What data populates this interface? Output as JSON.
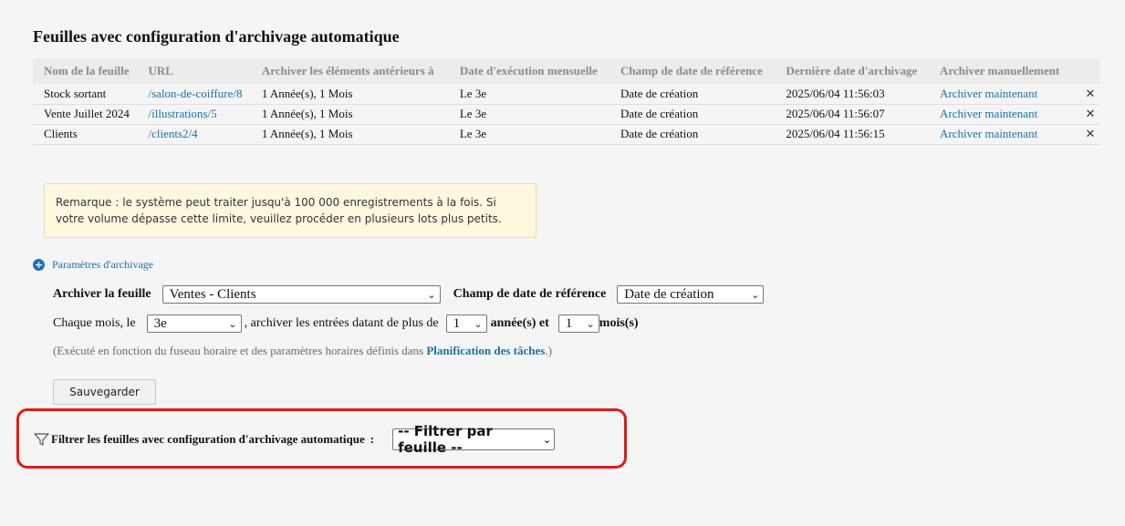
{
  "page": {
    "title": "Feuilles avec configuration d'archivage automatique"
  },
  "table": {
    "headers": [
      "Nom de la feuille",
      "URL",
      "Archiver les éléments antérieurs à",
      "Date d'exécution mensuelle",
      "Champ de date de référence",
      "Dernière date d'archivage",
      "Archiver manuellement"
    ],
    "rows": [
      {
        "name": "Stock sortant",
        "url": "/salon-de-coiffure/8",
        "older_than": "1 Année(s), 1 Mois",
        "monthly_date": "Le 3e",
        "ref_field": "Date de création",
        "last_archive": "2025/06/04 11:56:03",
        "action": "Archiver maintenant",
        "delete": "✕"
      },
      {
        "name": "Vente Juillet 2024",
        "url": "/illustrations/5",
        "older_than": "1 Année(s), 1 Mois",
        "monthly_date": "Le 3e",
        "ref_field": "Date de création",
        "last_archive": "2025/06/04 11:56:07",
        "action": "Archiver maintenant",
        "delete": "✕"
      },
      {
        "name": "Clients",
        "url": "/clients2/4",
        "older_than": "1 Année(s), 1 Mois",
        "monthly_date": "Le 3e",
        "ref_field": "Date de création",
        "last_archive": "2025/06/04 11:56:15",
        "action": "Archiver maintenant",
        "delete": "✕"
      }
    ]
  },
  "remark": {
    "text": "Remarque : le système peut traiter jusqu'à 100 000 enregistrements à la fois. Si votre volume dépasse cette limite, veuillez procéder en plusieurs lots plus petits."
  },
  "settings": {
    "toggle_icon": "+",
    "toggle_label": "Paramètres d'archivage",
    "sheet_label": "Archiver la feuille",
    "sheet_value": "Ventes - Clients",
    "ref_label": "Champ de date de référence",
    "ref_value": "Date de création",
    "each_month_label": "Chaque mois, le",
    "day_value": "3e",
    "archive_older_label": ", archiver les entrées datant de plus de",
    "years_value": "1",
    "years_label": "année(s) et",
    "months_value": "1",
    "months_label": "mois(s)",
    "hint_prefix": "(Exécuté en fonction du fuseau horaire et des paramètres horaires définis dans",
    "hint_link": "Planification des tâches",
    "hint_suffix": ".)",
    "save_label": "Sauvegarder"
  },
  "filter": {
    "label": "Filtrer les feuilles avec configuration d'archivage automatique",
    "colon": ":",
    "select_value": "-- Filtrer par feuille --",
    "highlight_color": "#e01b1b"
  },
  "colors": {
    "link": "#1f6fa8",
    "remark_bg": "#fff8e1"
  }
}
